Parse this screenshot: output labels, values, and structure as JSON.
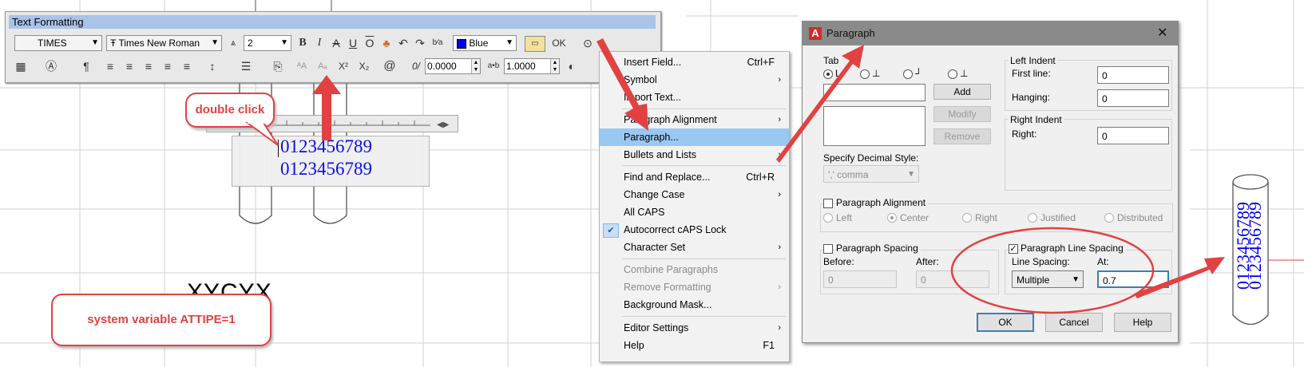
{
  "toolbar": {
    "title": "Text Formatting",
    "style": "TIMES",
    "font": "Times New Roman",
    "font_prefix": "Ŧ",
    "height": "2",
    "color": "Blue",
    "ok": "OK",
    "oblique_value": "0.0000",
    "tracking_value": "1.0000",
    "tracking_prefix": "a•b",
    "icons": [
      "annotative-icon",
      "bold-icon",
      "italic-icon",
      "strikethrough-icon",
      "underline-icon",
      "overline-icon",
      "match-icon",
      "undo-icon",
      "redo-icon",
      "stack-icon",
      "color-swatch",
      "ruler-icon",
      "options-icon",
      "columns-icon",
      "mtext-justify-icon",
      "paragraph-icon",
      "align-left-icon",
      "align-center-icon",
      "align-right-icon",
      "justify-icon",
      "distribute-icon",
      "line-spacing-icon",
      "numbering-icon",
      "insert-field-icon",
      "uppercase-icon",
      "lowercase-icon",
      "superscript-icon",
      "subscript-icon",
      "symbol-icon",
      "oblique-icon",
      "tracking-icon",
      "width-factor-icon"
    ],
    "superscript": "X²",
    "subscript": "X₂",
    "symbol": "@"
  },
  "editor": {
    "line1": "0123456789",
    "line2": "0123456789"
  },
  "callouts": {
    "double_click": "double click",
    "attipe": "system variable ATTIPE=1"
  },
  "background_text": "XYCYX",
  "menu": {
    "items": [
      {
        "label": "Insert Field...",
        "shortcut": "Ctrl+F"
      },
      {
        "label": "Symbol",
        "submenu": "›"
      },
      {
        "label": "Import Text..."
      },
      {
        "label": "Paragraph Alignment",
        "submenu": "›"
      },
      {
        "label": "Paragraph..."
      },
      {
        "label": "Bullets and Lists",
        "submenu": "›"
      },
      {
        "label": "Find and Replace...",
        "shortcut": "Ctrl+R"
      },
      {
        "label": "Change Case",
        "submenu": "›"
      },
      {
        "label": "All CAPS"
      },
      {
        "label": "Autocorrect cAPS Lock",
        "check": "✔"
      },
      {
        "label": "Character Set",
        "submenu": "›"
      },
      {
        "label": "Combine Paragraphs"
      },
      {
        "label": "Remove Formatting",
        "submenu": "›"
      },
      {
        "label": "Background Mask..."
      },
      {
        "label": "Editor Settings",
        "submenu": "›"
      },
      {
        "label": "Help",
        "shortcut": "F1"
      }
    ]
  },
  "dialog": {
    "title": "Paragraph",
    "app_icon_letter": "A",
    "close": "✕",
    "tab_label": "Tab",
    "tab_markers": [
      "L",
      "⊥",
      "┘",
      "⊥"
    ],
    "add": "Add",
    "modify": "Modify",
    "remove": "Remove",
    "decimal_label": "Specify Decimal Style:",
    "decimal_value": "',' comma",
    "left_indent": "Left Indent",
    "first_line_label": "First line:",
    "first_line_value": "0",
    "hanging_label": "Hanging:",
    "hanging_value": "0",
    "right_indent": "Right Indent",
    "right_label": "Right:",
    "right_value": "0",
    "para_alignment": "Paragraph Alignment",
    "align_options": [
      "Left",
      "Center",
      "Right",
      "Justified",
      "Distributed"
    ],
    "para_spacing": "Paragraph Spacing",
    "before_label": "Before:",
    "before_value": "0",
    "after_label": "After:",
    "after_value": "0",
    "line_spacing_group": "Paragraph Line Spacing",
    "line_spacing_label": "Line Spacing:",
    "line_spacing_value": "Multiple",
    "at_label": "At:",
    "at_value": "0.7",
    "ok": "OK",
    "cancel": "Cancel",
    "help": "Help"
  },
  "result": {
    "line1": "0123456789",
    "line2": "0123456789"
  },
  "colors": {
    "accent_red": "#e34141",
    "text_blue": "#0000ee",
    "menu_highlight": "#99c8f2",
    "toolbar_title": "#aac3e8"
  }
}
